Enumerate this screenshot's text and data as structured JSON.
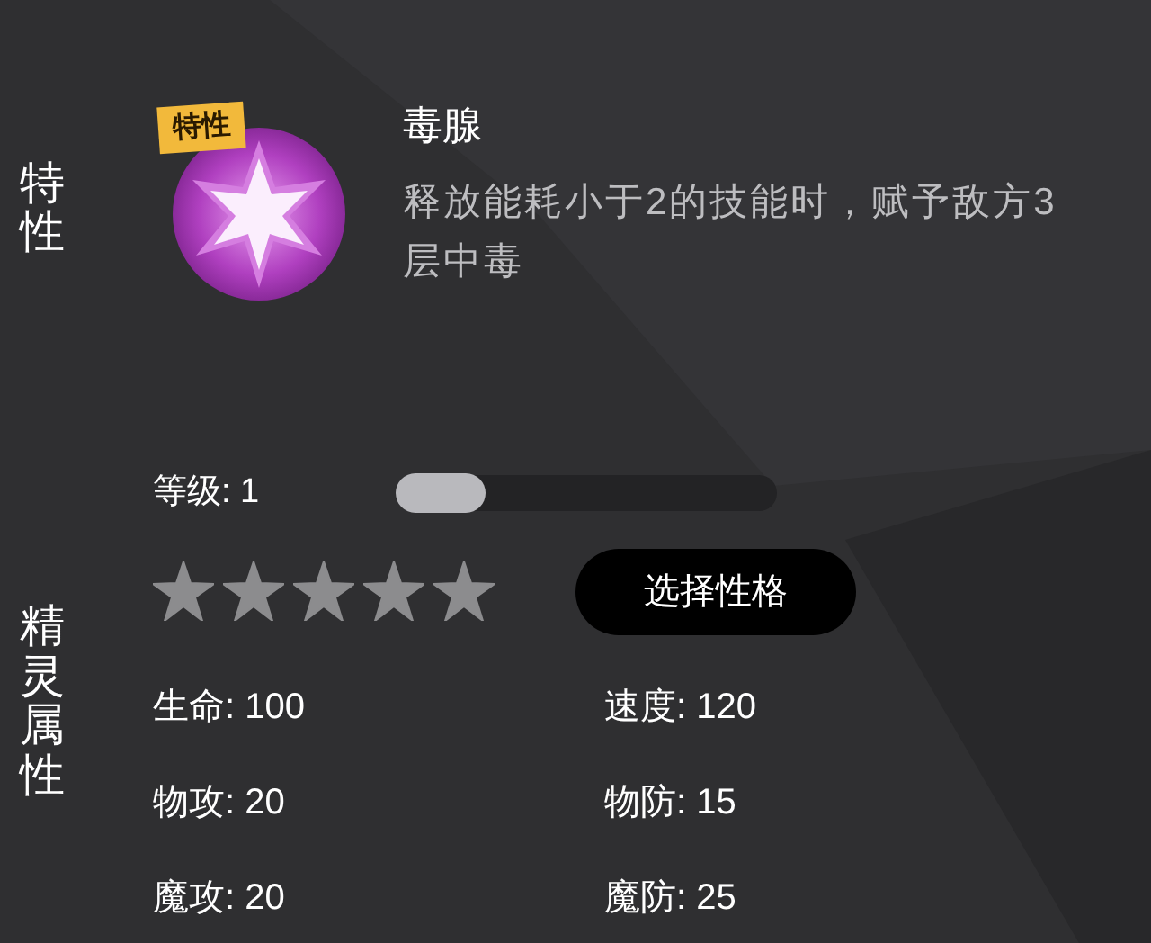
{
  "trait": {
    "section_label": "特性",
    "badge": "特性",
    "name": "毒腺",
    "description": "释放能耗小于2的技能时，赋予敌方3层中毒"
  },
  "attributes": {
    "section_label": "精灵属性",
    "level": {
      "label": "等级: 1",
      "level": 0
    },
    "stars": 5,
    "button": "选择性格",
    "stats": [
      {
        "text": "生命: 100"
      },
      {
        "text": "速度: 120"
      },
      {
        "text": "物攻: 20"
      },
      {
        "text": "物防: 15"
      },
      {
        "text": "魔攻: 20"
      },
      {
        "text": "魔防: 25"
      }
    ]
  }
}
